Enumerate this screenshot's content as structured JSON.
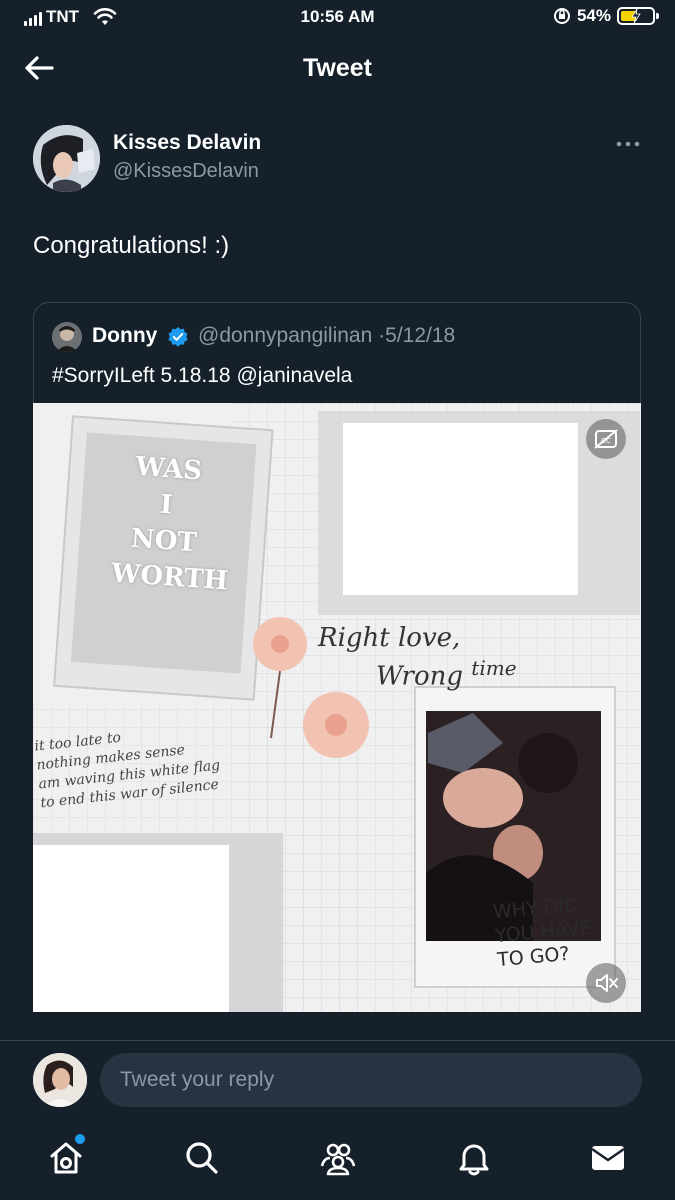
{
  "status_bar": {
    "carrier": "TNT",
    "time": "10:56 AM",
    "battery": "54%",
    "battery_level": 0.54,
    "battery_color": "#f5d200"
  },
  "header": {
    "title": "Tweet",
    "back_icon": "back-arrow-icon"
  },
  "tweet": {
    "author_name": "Kisses Delavin",
    "author_handle": "@KissesDelavin",
    "text": "Congratulations! :)",
    "more_icon": "more-dots-icon"
  },
  "quoted_tweet": {
    "author_name": "Donny",
    "verified": true,
    "author_handle": "@donnypangilinan",
    "separator": "·",
    "date": "5/12/18",
    "text": "#SorryILeft 5.18.18 @janinavela",
    "media": {
      "poster_words": [
        "WAS",
        "I",
        "NOT",
        "WORTH"
      ],
      "script_text": [
        "Right love,",
        "Wrong",
        "time"
      ],
      "handwriting_lines": [
        "it too late to",
        "nothing makes sense",
        "am waving this white flag",
        "to end this war of silence"
      ],
      "caption_lines": [
        "WHY DID",
        "YOU HAVE",
        "TO GO?"
      ],
      "top_icon": "captions-off-icon",
      "bottom_icon": "volume-mute-icon"
    }
  },
  "reply": {
    "placeholder": "Tweet your reply"
  },
  "tab_bar": {
    "items": [
      "home-icon",
      "search-icon",
      "communities-icon",
      "notifications-icon",
      "messages-icon"
    ],
    "accent": "#1d9bf0"
  },
  "colors": {
    "background": "#15202b",
    "secondary_text": "#8b98a5",
    "border": "#38444d",
    "verified_blue": "#1d9bf0"
  }
}
